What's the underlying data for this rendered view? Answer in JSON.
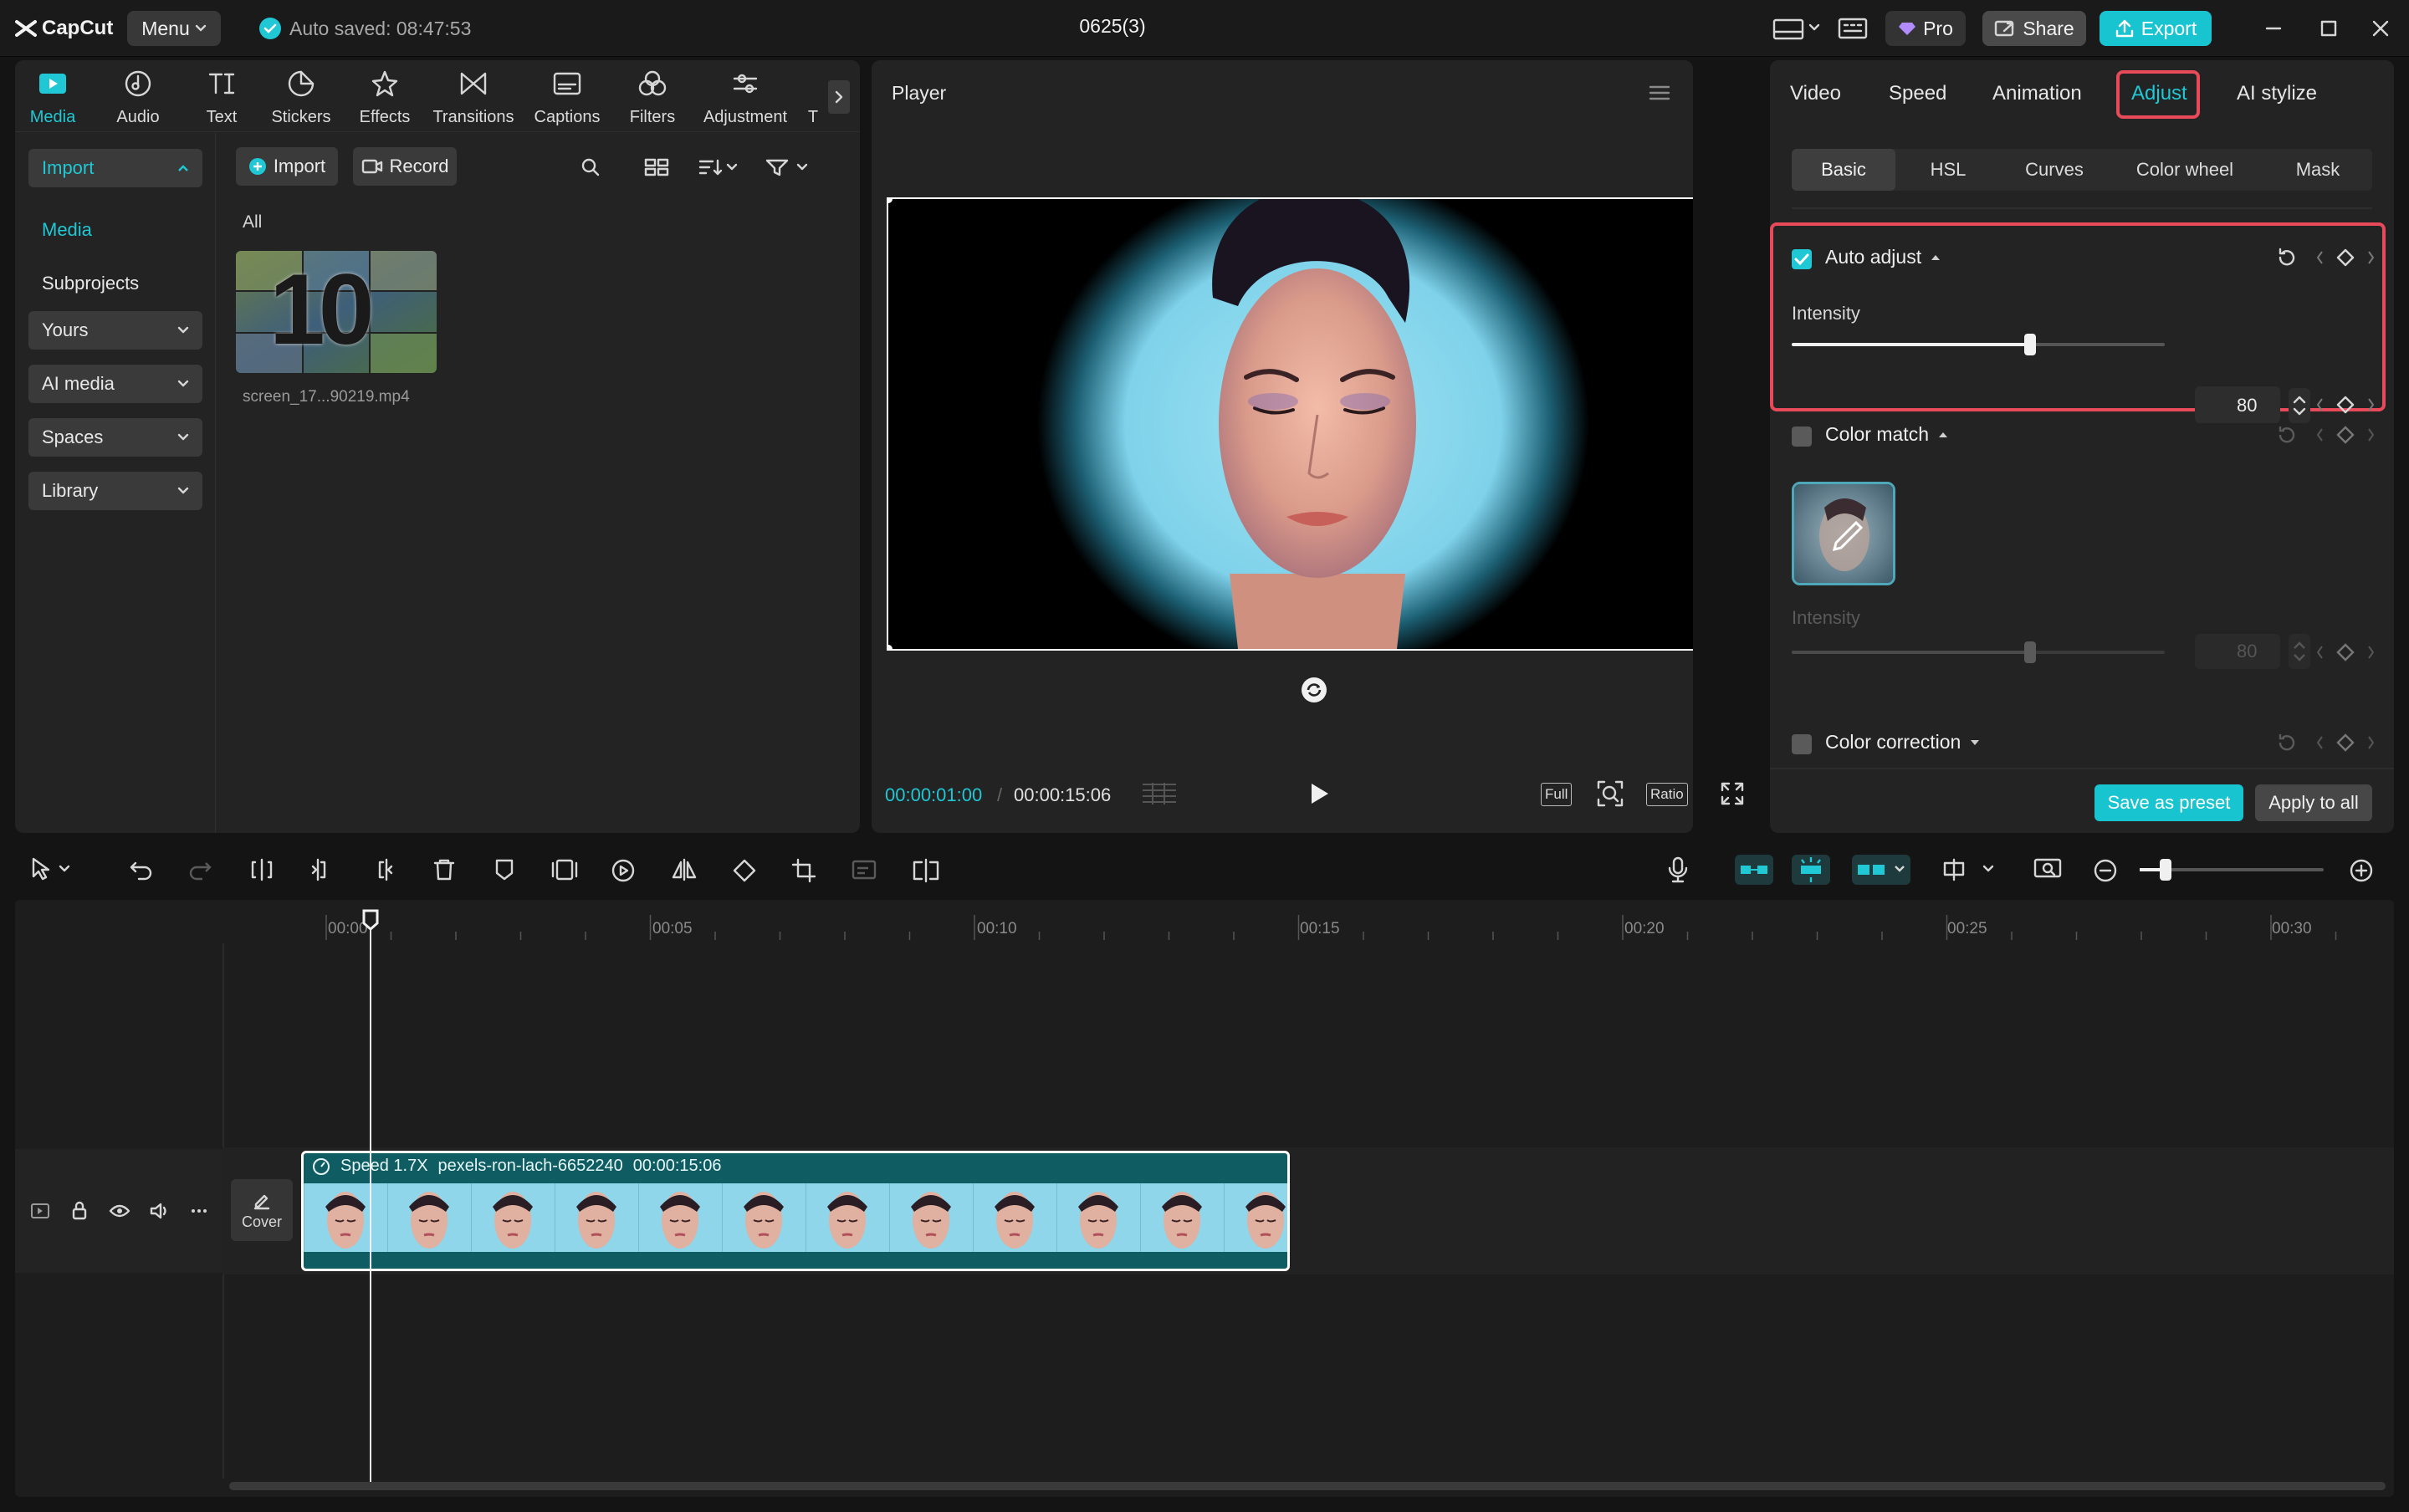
{
  "app": {
    "logo_text": "CapCut",
    "menu_label": "Menu",
    "autosave_text": "Auto saved: 08:47:53",
    "project_title": "0625(3)",
    "pro_label": "Pro",
    "share_label": "Share",
    "export_label": "Export"
  },
  "toolbar_tabs": [
    {
      "label": "Media",
      "icon": "media-icon"
    },
    {
      "label": "Audio",
      "icon": "audio-icon"
    },
    {
      "label": "Text",
      "icon": "text-icon"
    },
    {
      "label": "Stickers",
      "icon": "stickers-icon"
    },
    {
      "label": "Effects",
      "icon": "effects-icon"
    },
    {
      "label": "Transitions",
      "icon": "transitions-icon"
    },
    {
      "label": "Captions",
      "icon": "captions-icon"
    },
    {
      "label": "Filters",
      "icon": "filters-icon"
    },
    {
      "label": "Adjustment",
      "icon": "adjustment-icon"
    },
    {
      "label": "T",
      "icon": "templates-icon"
    }
  ],
  "media_sidebar": {
    "import": "Import",
    "media": "Media",
    "subprojects": "Subprojects",
    "yours": "Yours",
    "ai_media": "AI media",
    "spaces": "Spaces",
    "library": "Library"
  },
  "media_area": {
    "import_button": "Import",
    "record_button": "Record",
    "filter_all": "All",
    "items": [
      {
        "filename": "screen_17...90219.mp4",
        "thumb_text": "10"
      }
    ]
  },
  "player": {
    "title": "Player",
    "current_time": "00:00:01:00",
    "separator": "/",
    "duration": "00:00:15:06",
    "full_label": "Full",
    "ratio_label": "Ratio"
  },
  "inspector": {
    "tabs": [
      "Video",
      "Speed",
      "Animation",
      "Adjust",
      "AI stylize"
    ],
    "active_tab": "Adjust",
    "subtabs": [
      "Basic",
      "HSL",
      "Curves",
      "Color wheel",
      "Mask"
    ],
    "active_subtab": "Basic",
    "auto_adjust": {
      "label": "Auto adjust",
      "checked": true,
      "intensity_label": "Intensity",
      "intensity": 80
    },
    "color_match": {
      "label": "Color match",
      "checked": false,
      "intensity_label": "Intensity",
      "intensity": 80
    },
    "color_correction": {
      "label": "Color correction",
      "checked": false
    },
    "save_preset": "Save as preset",
    "apply_all": "Apply to all"
  },
  "timeline": {
    "ruler_labels": [
      "00:00",
      "00:05",
      "00:10",
      "00:15",
      "00:20",
      "00:25",
      "00:30"
    ],
    "cover_label": "Cover",
    "clip": {
      "speed": "Speed 1.7X",
      "name": "pexels-ron-lach-6652240",
      "duration": "00:00:15:06"
    }
  },
  "colors": {
    "accent": "#1fc8d4",
    "highlight": "#e84a5a",
    "clip_bg": "#0f5d63",
    "panel": "#232323"
  }
}
